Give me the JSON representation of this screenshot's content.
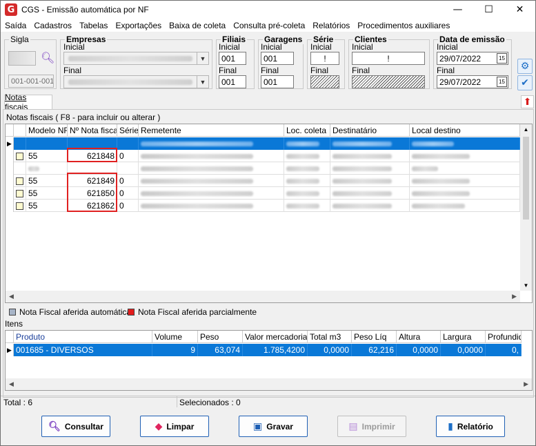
{
  "window": {
    "title": "CGS - Emissão automática por NF",
    "app_icon": "G",
    "minimize": "—",
    "maximize": "☐",
    "close": "✕"
  },
  "menu": [
    "Saída",
    "Cadastros",
    "Tabelas",
    "Exportações",
    "Baixa de coleta",
    "Consulta pré-coleta",
    "Relatórios",
    "Procedimentos auxiliares"
  ],
  "filters": {
    "sigla": {
      "title": "Sigla",
      "range": "001-001-001"
    },
    "empresas": {
      "title": "Empresas",
      "inicial_label": "Inicial",
      "final_label": "Final"
    },
    "filiais": {
      "title": "Filiais",
      "inicial_label": "Inicial",
      "inicial": "001",
      "final_label": "Final",
      "final": "001"
    },
    "garagens": {
      "title": "Garagens",
      "inicial_label": "Inicial",
      "inicial": "001",
      "final_label": "Final",
      "final": "001"
    },
    "serie": {
      "title": "Série",
      "inicial_label": "Inicial",
      "inicial": "!",
      "final_label": "Final"
    },
    "clientes": {
      "title": "Clientes",
      "inicial_label": "Inicial",
      "inicial": "!",
      "final_label": "Final"
    },
    "data_emissao": {
      "title": "Data de emissão",
      "inicial_label": "Inicial",
      "inicial": "29/07/2022",
      "final_label": "Final",
      "final": "29/07/2022",
      "cal_icon": "15"
    }
  },
  "tabs": {
    "notas": "Notas fiscais"
  },
  "notas_section": {
    "caption": "Notas fiscais ( F8 - para incluir ou alterar )",
    "columns": [
      "Modelo NF",
      "Nº Nota fiscal",
      "Série",
      "Remetente",
      "Loc. coleta",
      "Destinatário",
      "Local destino"
    ],
    "rows": [
      {
        "modelo": "",
        "nota": "",
        "serie": "",
        "selected": true,
        "checkbox": false
      },
      {
        "modelo": "55",
        "nota": "621848",
        "serie": "0",
        "selected": false,
        "checkbox": true
      },
      {
        "modelo": "",
        "nota": "",
        "serie": "",
        "selected": false,
        "checkbox": false
      },
      {
        "modelo": "55",
        "nota": "621849",
        "serie": "0",
        "selected": false,
        "checkbox": true
      },
      {
        "modelo": "55",
        "nota": "621850",
        "serie": "0",
        "selected": false,
        "checkbox": true
      },
      {
        "modelo": "55",
        "nota": "621862",
        "serie": "0",
        "selected": false,
        "checkbox": true
      }
    ]
  },
  "legend": {
    "auto": "Nota Fiscal aferida automática",
    "auto_color": "#a7b4c7",
    "partial": "Nota Fiscal aferida parcialmente",
    "partial_color": "#e21b1b"
  },
  "itens_section": {
    "caption": "Itens",
    "columns": [
      "Produto",
      "Volume",
      "Peso",
      "Valor mercadoria",
      "Total m3",
      "Peso Líq",
      "Altura",
      "Largura",
      "Profundid"
    ],
    "rows": [
      {
        "produto": "001685 - DIVERSOS",
        "volume": "9",
        "peso": "63,074",
        "valor": "1.785,4200",
        "total_m3": "0,0000",
        "peso_liq": "62,216",
        "altura": "0,0000",
        "largura": "0,0000",
        "profundid": "0,"
      }
    ]
  },
  "status": {
    "total": "Total : 6",
    "selecionados": "Selecionados : 0"
  },
  "buttons": {
    "consultar": "Consultar",
    "limpar": "Limpar",
    "gravar": "Gravar",
    "imprimir": "Imprimir",
    "relatorio": "Relatório"
  },
  "colors": {
    "selection": "#0a78d7",
    "accent": "#1e5fb4",
    "highlight_border": "#e02020"
  }
}
